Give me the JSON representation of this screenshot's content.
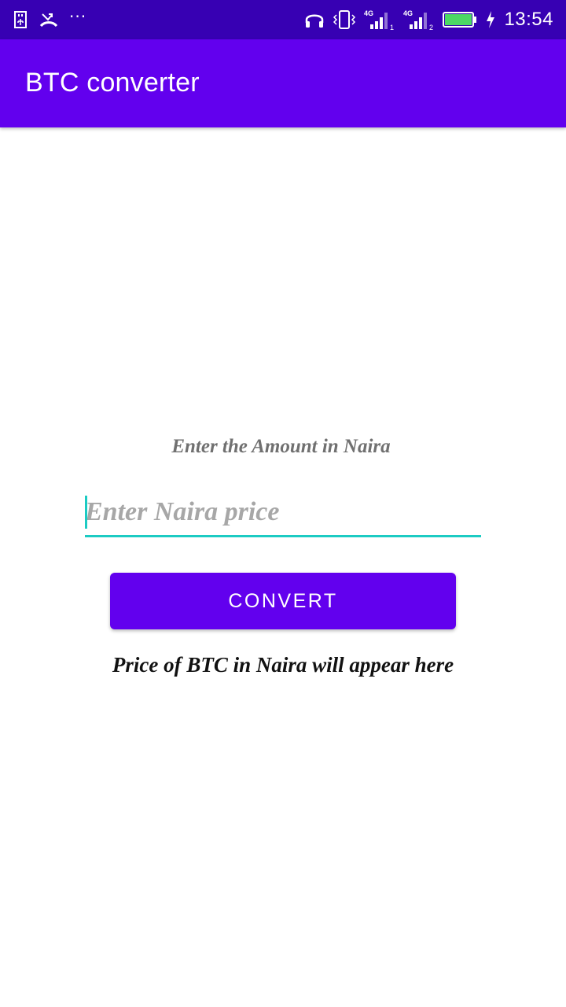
{
  "status_bar": {
    "time": "13:54",
    "left_icons": [
      "usb-icon",
      "missed-call-icon",
      "more-notifications-icon"
    ],
    "overflow_dots": "···",
    "right_icons": [
      "headset-icon",
      "vibrate-icon",
      "signal-sim1-icon",
      "signal-sim2-icon",
      "battery-icon",
      "charging-icon"
    ],
    "network_sim1": "4G",
    "network_sim2": "4G",
    "sim1_index": "1",
    "sim2_index": "2",
    "battery_level": 1.0,
    "battery_color": "#4cd964"
  },
  "app_bar": {
    "title": "BTC converter",
    "color": "#6200ee"
  },
  "form": {
    "prompt_label": "Enter the Amount in Naira",
    "input_placeholder": "Enter Naira price",
    "input_value": "",
    "accent_color": "#1ccbc3"
  },
  "convert_button": {
    "label": "CONVERT",
    "color": "#6200ee"
  },
  "result": {
    "text": "Price of BTC in Naira will appear here"
  }
}
